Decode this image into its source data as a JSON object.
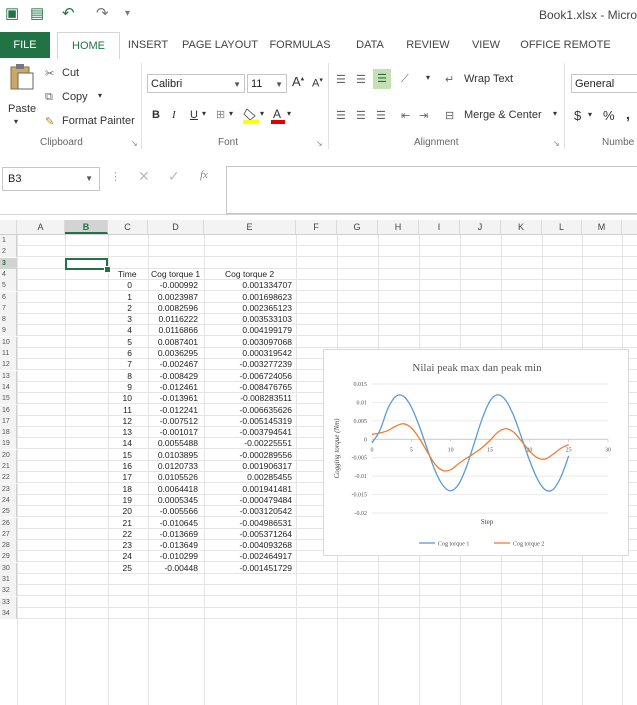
{
  "window": {
    "title": "Book1.xlsx - Micro"
  },
  "tabs": [
    "FILE",
    "HOME",
    "INSERT",
    "PAGE LAYOUT",
    "FORMULAS",
    "DATA",
    "REVIEW",
    "VIEW",
    "OFFICE REMOTE"
  ],
  "ribbon": {
    "clipboard": {
      "paste": "Paste",
      "cut": "Cut",
      "copy": "Copy",
      "painter": "Format Painter",
      "group": "Clipboard"
    },
    "font": {
      "name": "Calibri",
      "size": "11",
      "group": "Font"
    },
    "alignment": {
      "wrap": "Wrap Text",
      "merge": "Merge & Center",
      "group": "Alignment"
    },
    "number": {
      "format": "General",
      "currency": "$",
      "percent": "%",
      "comma": ",",
      "group": "Numbe"
    }
  },
  "formula_bar": {
    "name_box": "B3",
    "fx": "fx",
    "value": ""
  },
  "columns": [
    "A",
    "B",
    "C",
    "D",
    "E",
    "F",
    "G",
    "H",
    "I",
    "J",
    "K",
    "L",
    "M"
  ],
  "selected": {
    "col": "B",
    "row": "3"
  },
  "table": {
    "headers": [
      "Time",
      "Cog torque 1",
      "Cog torque 2"
    ],
    "rows": [
      [
        "0",
        "-0.000992",
        "0.001334707"
      ],
      [
        "1",
        "0.0023987",
        "0.001698623"
      ],
      [
        "2",
        "0.0082596",
        "0.002365123"
      ],
      [
        "3",
        "0.0116222",
        "0.003533103"
      ],
      [
        "4",
        "0.0116866",
        "0.004199179"
      ],
      [
        "5",
        "0.0087401",
        "0.003097068"
      ],
      [
        "6",
        "0.0036295",
        "0.000319542"
      ],
      [
        "7",
        "-0.002467",
        "-0.003277239"
      ],
      [
        "8",
        "-0.008429",
        "-0.006724056"
      ],
      [
        "9",
        "-0.012461",
        "-0.008476765"
      ],
      [
        "10",
        "-0.013961",
        "-0.008283511"
      ],
      [
        "11",
        "-0.012241",
        "-0.006635626"
      ],
      [
        "12",
        "-0.007512",
        "-0.005145319"
      ],
      [
        "13",
        "-0.001017",
        "-0.003794541"
      ],
      [
        "14",
        "0.0055488",
        "-0.00225551"
      ],
      [
        "15",
        "0.0103895",
        "-0.000289556"
      ],
      [
        "16",
        "0.0120733",
        "0.001906317"
      ],
      [
        "17",
        "0.0105526",
        "0.00285455"
      ],
      [
        "18",
        "0.0064418",
        "0.001941481"
      ],
      [
        "19",
        "0.0005345",
        "-0.000479484"
      ],
      [
        "20",
        "-0.005566",
        "-0.003120542"
      ],
      [
        "21",
        "-0.010645",
        "-0.004986531"
      ],
      [
        "22",
        "-0.013669",
        "-0.005371264"
      ],
      [
        "23",
        "-0.013649",
        "-0.004093268"
      ],
      [
        "24",
        "-0.010299",
        "-0.002464917"
      ],
      [
        "25",
        "-0.00448",
        "-0.001451729"
      ]
    ]
  },
  "chart_data": {
    "type": "line",
    "title": "Nilai peak max dan peak min",
    "xlabel": "Step",
    "ylabel": "Cogging torque (Nm)",
    "xlim": [
      0,
      30
    ],
    "ylim": [
      -0.02,
      0.015
    ],
    "xticks": [
      "0",
      "5",
      "10",
      "15",
      "20",
      "25",
      "30"
    ],
    "yticks": [
      "0.015",
      "0.01",
      "0.005",
      "0",
      "-0.005",
      "-0.01",
      "-0.015",
      "-0.02"
    ],
    "legend_position": "bottom",
    "series": [
      {
        "name": "Cog torque 1",
        "color": "#5b9bd5",
        "values": [
          -0.000992,
          0.0023987,
          0.0082596,
          0.0116222,
          0.0116866,
          0.0087401,
          0.0036295,
          -0.002467,
          -0.008429,
          -0.012461,
          -0.013961,
          -0.012241,
          -0.007512,
          -0.001017,
          0.0055488,
          0.0103895,
          0.0120733,
          0.0105526,
          0.0064418,
          0.0005345,
          -0.005566,
          -0.010645,
          -0.013669,
          -0.013649,
          -0.010299,
          -0.00448
        ]
      },
      {
        "name": "Cog torque 2",
        "color": "#ed7d31",
        "values": [
          0.001334707,
          0.001698623,
          0.002365123,
          0.003533103,
          0.004199179,
          0.003097068,
          0.000319542,
          -0.003277239,
          -0.006724056,
          -0.008476765,
          -0.008283511,
          -0.006635626,
          -0.005145319,
          -0.003794541,
          -0.00225551,
          -0.000289556,
          0.001906317,
          0.00285455,
          0.001941481,
          -0.000479484,
          -0.003120542,
          -0.004986531,
          -0.005371264,
          -0.004093268,
          -0.002464917,
          -0.001451729
        ]
      }
    ]
  }
}
